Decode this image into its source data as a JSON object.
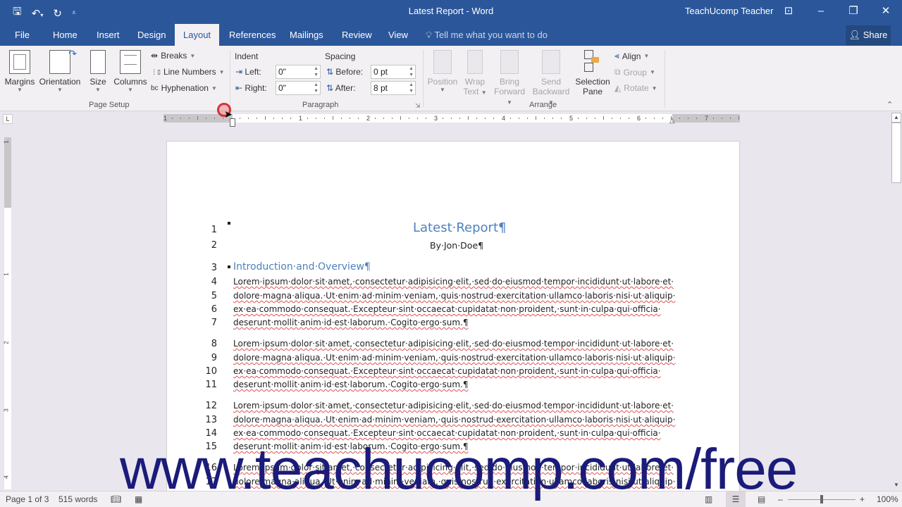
{
  "titlebar": {
    "title": "Latest Report - Word",
    "user": "TeachUcomp Teacher",
    "qat": {
      "save": "save-icon",
      "undo": "undo-icon",
      "redo": "redo-icon",
      "customize": "customize-icon"
    }
  },
  "tabs": [
    "File",
    "Home",
    "Insert",
    "Design",
    "Layout",
    "References",
    "Mailings",
    "Review",
    "View"
  ],
  "active_tab": "Layout",
  "tellme": "Tell me what you want to do",
  "share": "Share",
  "ribbon": {
    "page_setup": {
      "label": "Page Setup",
      "margins": "Margins",
      "orientation": "Orientation",
      "size": "Size",
      "columns": "Columns",
      "breaks": "Breaks",
      "line_numbers": "Line Numbers",
      "hyphenation": "Hyphenation"
    },
    "paragraph": {
      "label": "Paragraph",
      "indent": "Indent",
      "spacing": "Spacing",
      "left_label": "Left:",
      "right_label": "Right:",
      "before_label": "Before:",
      "after_label": "After:",
      "left_value": "0\"",
      "right_value": "0\"",
      "before_value": "0 pt",
      "after_value": "8 pt"
    },
    "arrange": {
      "label": "Arrange",
      "position": "Position",
      "wrap_text_1": "Wrap",
      "wrap_text_2": "Text",
      "bring_forward_1": "Bring",
      "bring_forward_2": "Forward",
      "send_backward_1": "Send",
      "send_backward_2": "Backward",
      "selection_pane_1": "Selection",
      "selection_pane_2": "Pane",
      "align": "Align",
      "group": "Group",
      "rotate": "Rotate"
    }
  },
  "ruler": {
    "numbers": [
      "1",
      "1",
      "2",
      "3",
      "4",
      "5",
      "6",
      "7"
    ]
  },
  "vruler": {
    "numbers": [
      "1",
      "1",
      "2",
      "3",
      "4"
    ]
  },
  "document": {
    "title": "Latest·Report¶",
    "byline": "By·Jon·Doe¶",
    "heading": "Introduction·and·Overview¶",
    "para_lines": [
      "Lorem·ipsum·dolor·sit·amet,·consectetur·adipisicing·elit,·sed·do·eiusmod·tempor·incididunt·ut·labore·et·",
      "dolore·magna·aliqua.·Ut·enim·ad·minim·veniam,·quis·nostrud·exercitation·ullamco·laboris·nisi·ut·aliquip·",
      "ex·ea·commodo·consequat.·Excepteur·sint·occaecat·cupidatat·non·proident,·sunt·in·culpa·qui·officia·",
      "deserunt·mollit·anim·id·est·laborum.·Cogito·ergo·sum.¶"
    ],
    "line_numbers": [
      "1",
      "2",
      "3",
      "4",
      "5",
      "6",
      "7",
      "8",
      "9",
      "10",
      "11",
      "12",
      "13",
      "14",
      "15",
      "16",
      "17"
    ]
  },
  "status": {
    "page": "Page 1 of 3",
    "words": "515 words",
    "zoom": "100%"
  },
  "watermark": "www.teachucomp.com/free"
}
